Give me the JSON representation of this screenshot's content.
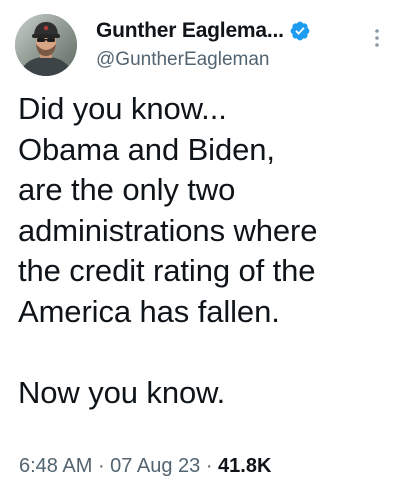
{
  "author": {
    "display_name": "Gunther Eaglema...",
    "handle": "@GuntherEagleman",
    "verified_color": "#1d9bf0"
  },
  "tweet": {
    "text": "Did you know...\nObama and Biden,\nare the only two\nadministrations where\nthe credit rating of the\nAmerica has fallen.\n\nNow you know."
  },
  "meta": {
    "time": "6:48 AM",
    "sep1": " · ",
    "date": "07 Aug 23",
    "sep2": " · ",
    "views": "41.8K"
  },
  "icons": {
    "verified": "verified-badge-icon",
    "more": "more-options-icon"
  }
}
